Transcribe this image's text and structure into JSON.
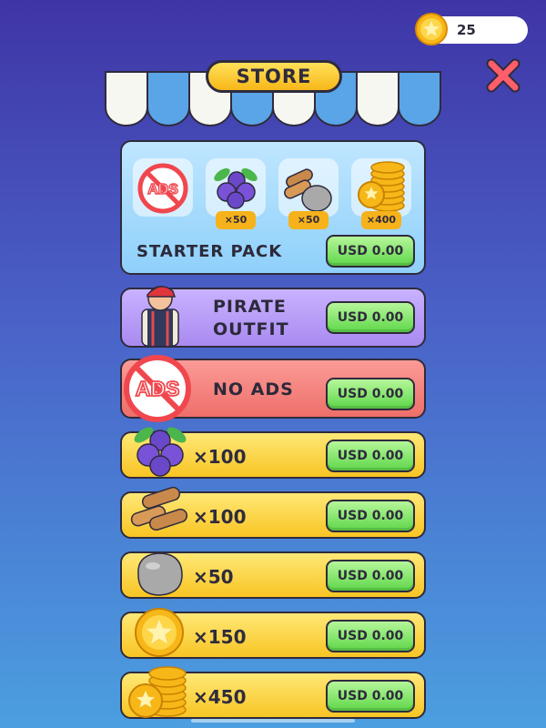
{
  "currency": {
    "coins": "25",
    "icon": "coin-icon"
  },
  "header": {
    "title": "STORE",
    "close_icon": "close-icon"
  },
  "starter_pack": {
    "title": "STARTER PACK",
    "price": "USD 0.00",
    "items": [
      {
        "icon": "no-ads-icon",
        "label": "ADS",
        "qty": ""
      },
      {
        "icon": "berries-icon",
        "qty": "×50"
      },
      {
        "icon": "wood-stone-icon",
        "qty": "×50"
      },
      {
        "icon": "coin-stack-icon",
        "qty": "×400"
      }
    ]
  },
  "offers": [
    {
      "name": "PIRATE\nOUTFIT",
      "line1": "PIRATE",
      "line2": "OUTFIT",
      "price": "USD 0.00",
      "color": "#b79af5"
    },
    {
      "name": "NO ADS",
      "ads_label": "ADS",
      "price": "USD 0.00",
      "color": "#f48a85"
    },
    {
      "qty": "×100",
      "item": "berries",
      "price": "USD 0.00"
    },
    {
      "qty": "×100",
      "item": "wood",
      "price": "USD 0.00"
    },
    {
      "qty": "×50",
      "item": "stone",
      "price": "USD 0.00"
    },
    {
      "qty": "×150",
      "item": "coin",
      "price": "USD 0.00"
    },
    {
      "qty": "×450",
      "item": "coin-stack",
      "price": "USD 0.00"
    }
  ],
  "colors": {
    "gold": "#fdd437",
    "price_green": "#5fd74a",
    "starter_bg": "#a3d9fb"
  }
}
